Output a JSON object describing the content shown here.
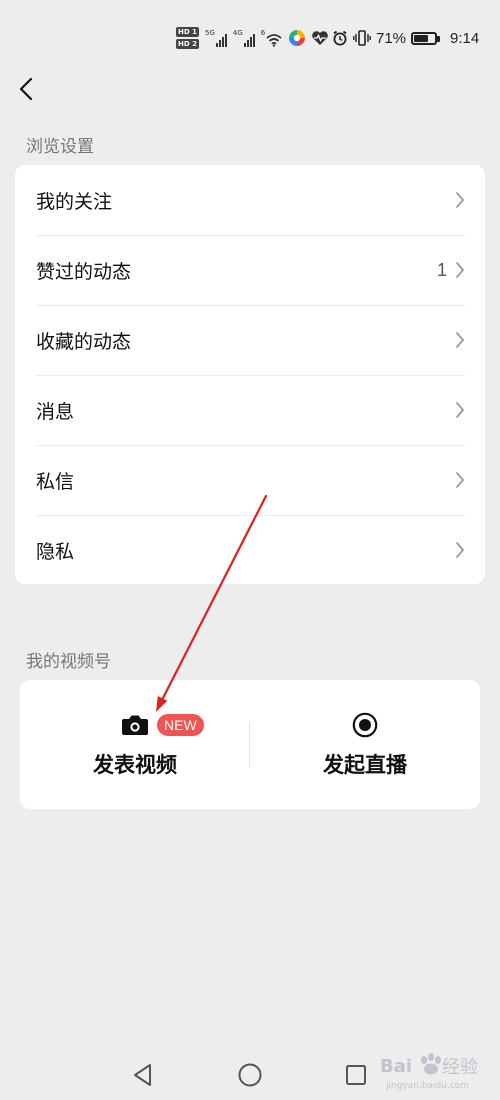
{
  "status_bar": {
    "hd1": "HD 1",
    "hd2": "HD 2",
    "signal1_label": "5G",
    "signal2_label": "4G",
    "wifi_label": "6",
    "icons": [
      "wifi-icon",
      "colorful-app-icon",
      "heart-health-icon",
      "alarm-icon",
      "vibrate-icon"
    ],
    "battery_percent": "71%",
    "battery_level": 0.71,
    "time": "9:14"
  },
  "header": {
    "back_icon": "chevron-left-icon"
  },
  "browse_section": {
    "title": "浏览设置",
    "items": [
      {
        "label": "我的关注",
        "count": ""
      },
      {
        "label": "赞过的动态",
        "count": "1"
      },
      {
        "label": "收藏的动态",
        "count": ""
      },
      {
        "label": "消息",
        "count": ""
      },
      {
        "label": "私信",
        "count": ""
      },
      {
        "label": "隐私",
        "count": ""
      }
    ]
  },
  "video_section": {
    "title": "我的视频号",
    "publish": {
      "label": "发表视频",
      "badge": "NEW",
      "icon": "camera-icon"
    },
    "live": {
      "label": "发起直播",
      "icon": "record-icon"
    }
  },
  "nav_bar": {
    "icons": [
      "back-triangle-icon",
      "home-circle-icon",
      "recents-square-icon"
    ]
  },
  "colors": {
    "background": "#ededed",
    "card": "#ffffff",
    "badge": "#f05555",
    "annotation": "#e02020"
  }
}
